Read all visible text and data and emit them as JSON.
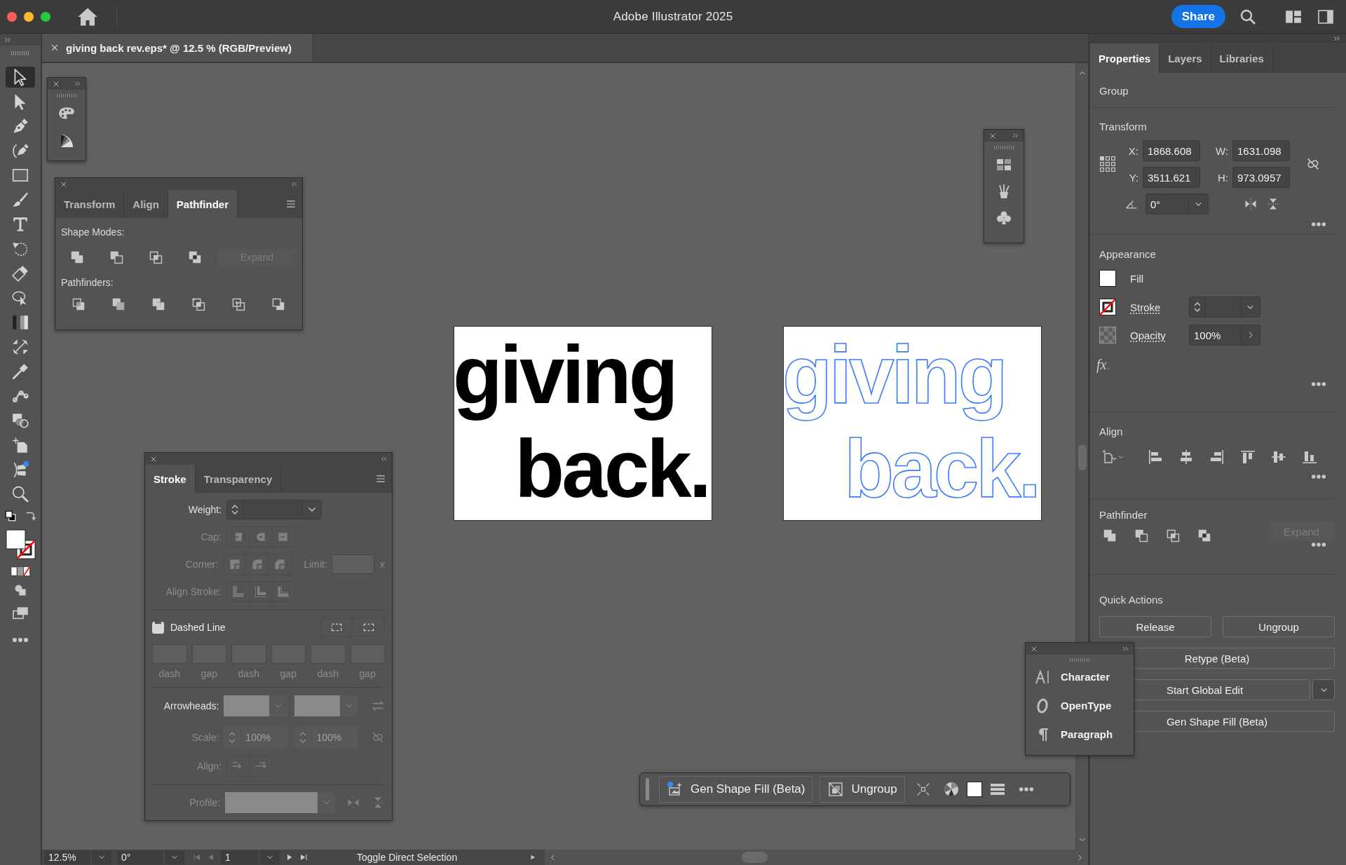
{
  "window": {
    "title": "Adobe Illustrator 2025",
    "share_button": "Share"
  },
  "document_tab": {
    "title": "giving back rev.eps* @ 12.5 % (RGB/Preview)"
  },
  "tools": [
    {
      "kind": "selection",
      "selected": true
    },
    {
      "kind": "direct-selection",
      "selected": false
    },
    {
      "kind": "pen",
      "selected": false
    },
    {
      "kind": "curvature",
      "selected": false
    },
    {
      "kind": "rectangle",
      "selected": false
    },
    {
      "kind": "paintbrush",
      "selected": false
    },
    {
      "kind": "type",
      "selected": false
    },
    {
      "kind": "rotate",
      "selected": false
    },
    {
      "kind": "eraser",
      "selected": false
    },
    {
      "kind": "comment",
      "selected": false
    },
    {
      "kind": "gradient",
      "selected": false
    },
    {
      "kind": "width",
      "selected": false
    },
    {
      "kind": "eyedropper",
      "selected": false
    },
    {
      "kind": "puppet-warp",
      "selected": false
    },
    {
      "kind": "shape-builder",
      "selected": false
    },
    {
      "kind": "artboard",
      "selected": false
    },
    {
      "kind": "bar-chart",
      "selected": false
    },
    {
      "kind": "zoom",
      "selected": false
    }
  ],
  "pathfinder_panel": {
    "tabs": [
      {
        "label": "Transform",
        "selected": false
      },
      {
        "label": "Align",
        "selected": false
      },
      {
        "label": "Pathfinder",
        "selected": true
      }
    ],
    "shape_modes_label": "Shape Modes:",
    "expand_button": {
      "label": "Expand",
      "disabled": true
    },
    "pathfinders_label": "Pathfinders:"
  },
  "stroke_panel": {
    "tabs": [
      {
        "label": "Stroke",
        "selected": true
      },
      {
        "label": "Transparency",
        "selected": false
      }
    ],
    "options_disabled": true,
    "weight_label": "Weight:",
    "cap_label": "Cap:",
    "corner_label": "Corner:",
    "limit_label": "Limit:",
    "limit_unit": "x",
    "align_stroke_label": "Align Stroke:",
    "dashed_line": {
      "label": "Dashed Line",
      "mixed": true
    },
    "dash_labels": [
      "dash",
      "gap",
      "dash",
      "gap",
      "dash",
      "gap"
    ],
    "arrowheads_label": "Arrowheads:",
    "scale_label": "Scale:",
    "scale_values": [
      "100%",
      "100%"
    ],
    "align_label": "Align:",
    "profile_label": "Profile:"
  },
  "artboards": [
    {
      "kind": "filled",
      "lines": [
        "giving",
        "back."
      ]
    },
    {
      "kind": "outlined",
      "lines": [
        "giving",
        "back."
      ]
    }
  ],
  "character_panel": {
    "items": [
      {
        "kind": "character",
        "label": "Character"
      },
      {
        "kind": "opentype",
        "label": "OpenType"
      },
      {
        "kind": "paragraph",
        "label": "Paragraph"
      }
    ]
  },
  "task_bar": {
    "buttons": [
      {
        "kind": "gen-fill",
        "label": "Gen Shape Fill (Beta)"
      },
      {
        "kind": "ungroup",
        "label": "Ungroup"
      }
    ]
  },
  "properties_panel": {
    "tabs": [
      {
        "label": "Properties",
        "selected": true
      },
      {
        "label": "Layers",
        "selected": false
      },
      {
        "label": "Libraries",
        "selected": false
      }
    ],
    "selection_type": "Group",
    "transform": {
      "title": "Transform",
      "fields": [
        {
          "label": "X:",
          "value": "1868.608"
        },
        {
          "label": "W:",
          "value": "1631.098"
        },
        {
          "label": "Y:",
          "value": "3511.621"
        },
        {
          "label": "H:",
          "value": "973.0957"
        }
      ],
      "angle": "0°"
    },
    "appearance": {
      "title": "Appearance",
      "fill_label": "Fill",
      "stroke_label": "Stroke",
      "opacity_label": "Opacity",
      "opacity": "100%",
      "fx": "fx"
    },
    "align": {
      "title": "Align"
    },
    "pathfinder": {
      "title": "Pathfinder",
      "expand_button": {
        "label": "Expand",
        "disabled": true
      }
    },
    "quick_actions": {
      "title": "Quick Actions",
      "buttons": [
        {
          "label": "Release",
          "kind": "half"
        },
        {
          "label": "Ungroup",
          "kind": "half"
        },
        {
          "label": "Retype (Beta)",
          "kind": "full"
        },
        {
          "label": "Start Global Edit",
          "kind": "split"
        },
        {
          "label": "Gen Shape Fill (Beta)",
          "kind": "full"
        }
      ]
    }
  },
  "status_bar": {
    "zoom": "12.5%",
    "rotation": "0°",
    "artboard": "1",
    "tool_hint": "Toggle Direct Selection"
  }
}
